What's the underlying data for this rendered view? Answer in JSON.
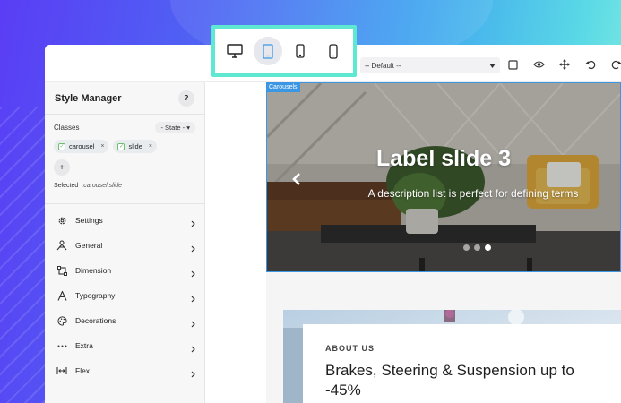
{
  "device_switcher": {
    "devices": [
      {
        "name": "desktop",
        "icon": "desktop-icon"
      },
      {
        "name": "tablet",
        "icon": "tablet-icon",
        "active": true
      },
      {
        "name": "mobile-landscape",
        "icon": "mobile-landscape-icon"
      },
      {
        "name": "mobile-portrait",
        "icon": "mobile-portrait-icon"
      }
    ],
    "accent": "#5ee8d2"
  },
  "toolbar": {
    "device_select_value": "-- Default --",
    "icons": [
      "square-outline-icon",
      "eye-icon",
      "move-icon",
      "undo-icon",
      "redo-icon"
    ]
  },
  "style_manager": {
    "title": "Style Manager",
    "help_label": "?",
    "classes_label": "Classes",
    "state_label": "- State -",
    "tags": [
      {
        "label": "carousel",
        "remove": "×"
      },
      {
        "label": "slide",
        "remove": "×"
      }
    ],
    "add_label": "+",
    "selected_label": "Selected",
    "selected_value": ".carousel.slide",
    "sectors": [
      {
        "label": "Settings",
        "icon": "gear-icon"
      },
      {
        "label": "General",
        "icon": "general-icon"
      },
      {
        "label": "Dimension",
        "icon": "dimension-icon"
      },
      {
        "label": "Typography",
        "icon": "typography-icon"
      },
      {
        "label": "Decorations",
        "icon": "palette-icon"
      },
      {
        "label": "Extra",
        "icon": "dots-icon"
      },
      {
        "label": "Flex",
        "icon": "flex-icon"
      }
    ]
  },
  "canvas": {
    "badge": "Carousels",
    "badge_color": "#3b97e3",
    "slide": {
      "label": "Label slide 3",
      "description": "A description list is perfect for defining terms",
      "dots": 3,
      "active_dot": 3
    },
    "about": {
      "eyebrow": "ABOUT US",
      "title": "Brakes, Steering & Suspension up to -45%"
    }
  }
}
